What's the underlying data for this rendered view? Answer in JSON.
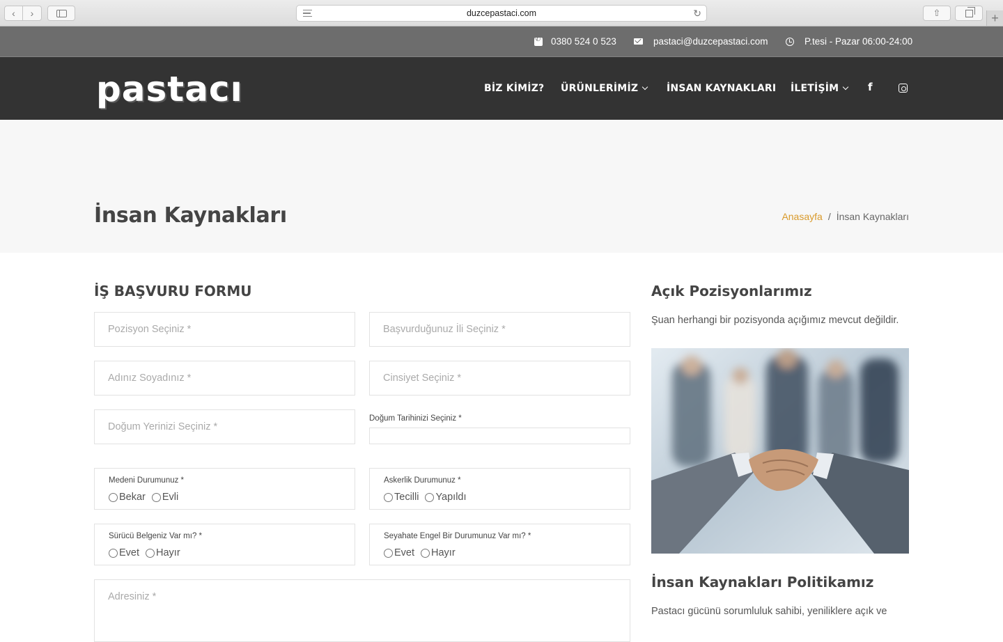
{
  "browser": {
    "url": "duzcepastaci.com"
  },
  "topbar": {
    "phone": "0380 524 0 523",
    "email": "pastaci@duzcepastaci.com",
    "hours": "P.tesi - Pazar 06:00-24:00"
  },
  "header": {
    "logo": "pastacı",
    "menu": [
      {
        "label": "BİZ KİMİZ?"
      },
      {
        "label": "ÜRÜNLERİMİZ"
      },
      {
        "label": "İNSAN KAYNAKLARI"
      },
      {
        "label": "İLETİŞİM"
      }
    ],
    "social": {
      "facebook": "f"
    }
  },
  "page": {
    "title": "İnsan Kaynakları",
    "breadcrumb": {
      "home": "Anasayfa",
      "sep": "/",
      "current": "İnsan Kaynakları"
    }
  },
  "form": {
    "title": "İŞ BAŞVURU FORMU",
    "position_placeholder": "Pozisyon Seçiniz *",
    "city_placeholder": "Başvurduğunuz İli Seçiniz *",
    "name_placeholder": "Adınız Soyadınız *",
    "gender_placeholder": "Cinsiyet Seçiniz *",
    "birthplace_placeholder": "Doğum Yerinizi Seçiniz *",
    "birthdate_label": "Doğum Tarihinizi Seçiniz *",
    "marital": {
      "label": "Medeni Durumunuz *",
      "options": [
        "Bekar",
        "Evli"
      ]
    },
    "military": {
      "label": "Askerlik Durumunuz *",
      "options": [
        "Tecilli",
        "Yapıldı"
      ]
    },
    "license": {
      "label": "Sürücü Belgeniz Var mı? *",
      "options": [
        "Evet",
        "Hayır"
      ]
    },
    "travel": {
      "label": "Seyahate Engel Bir Durumunuz Var mı? *",
      "options": [
        "Evet",
        "Hayır"
      ]
    },
    "address_placeholder": "Adresiniz *"
  },
  "sidebar": {
    "positions_title": "Açık Pozisyonlarımız",
    "positions_text": "Şuan herhangi bir pozisyonda açığımız mevcut değildir.",
    "policy_title": "İnsan Kaynakları Politikamız",
    "policy_text": "Pastacı gücünü sorumluluk sahibi, yeniliklere açık ve"
  }
}
